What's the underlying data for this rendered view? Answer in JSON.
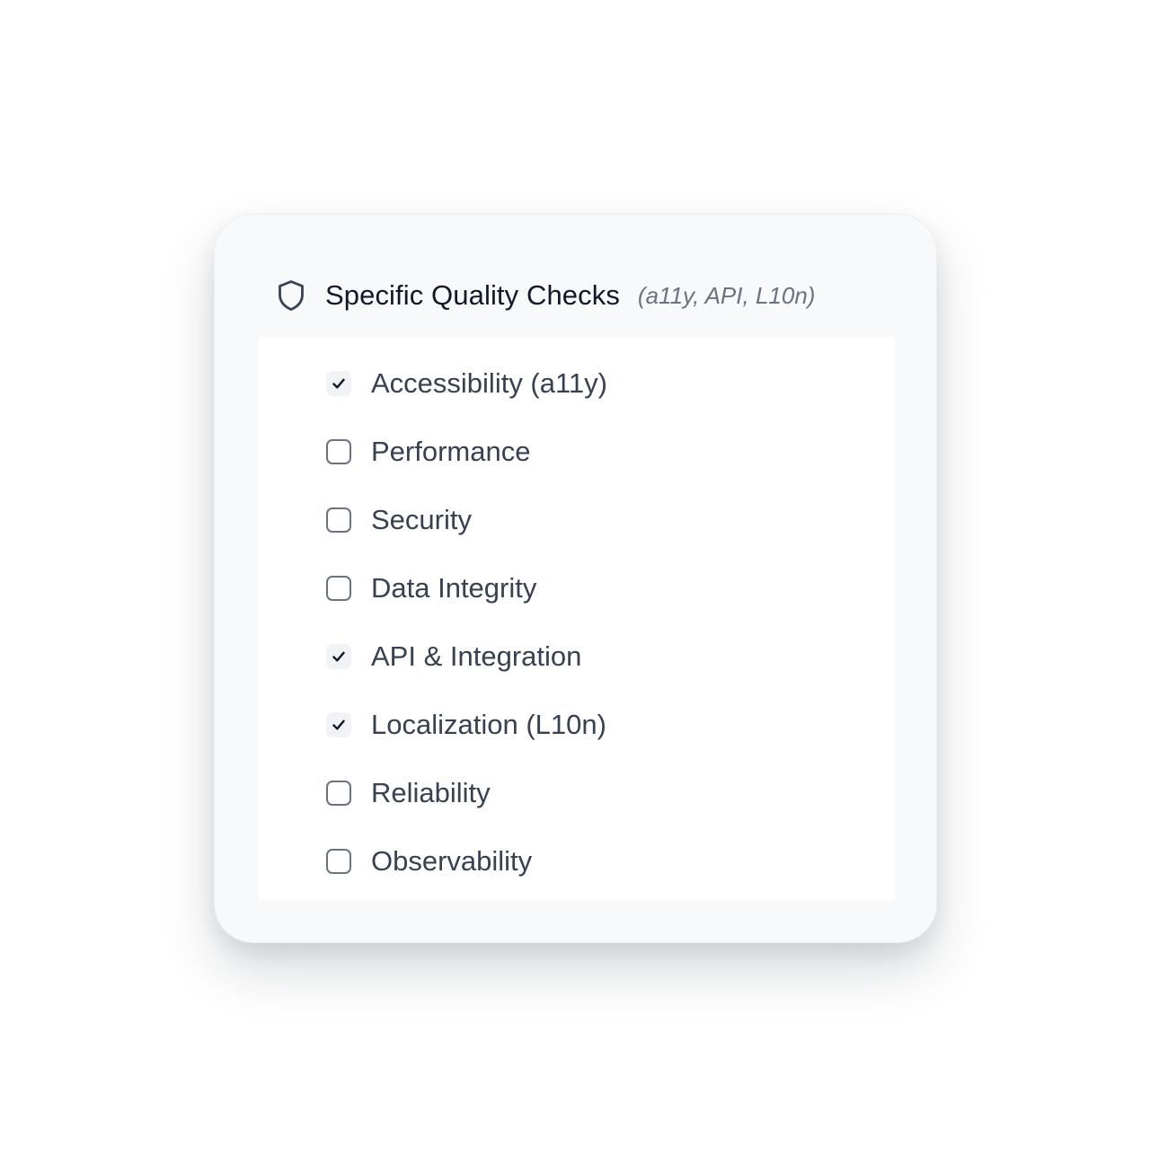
{
  "panel": {
    "icon": "shield-icon",
    "title": "Specific Quality Checks",
    "subtitle": "(a11y, API, L10n)"
  },
  "checks": [
    {
      "label": "Accessibility (a11y)",
      "checked": true
    },
    {
      "label": "Performance",
      "checked": false
    },
    {
      "label": "Security",
      "checked": false
    },
    {
      "label": "Data Integrity",
      "checked": false
    },
    {
      "label": "API & Integration",
      "checked": true
    },
    {
      "label": "Localization (L10n)",
      "checked": true
    },
    {
      "label": "Reliability",
      "checked": false
    },
    {
      "label": "Observability",
      "checked": false
    }
  ],
  "colors": {
    "card_background": "#f8f9fb",
    "list_background": "#ffffff",
    "title_text": "#111827",
    "subtitle_text": "#6b7280",
    "label_text": "#374151",
    "checkbox_border": "#6b7280",
    "checkmark": "#111827"
  }
}
